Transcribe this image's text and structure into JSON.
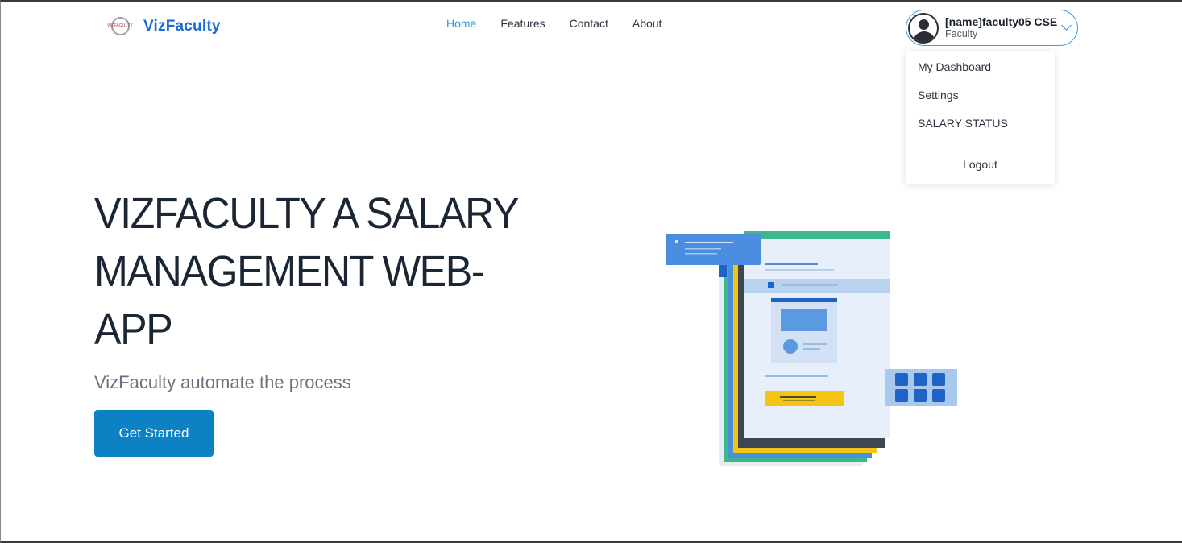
{
  "brand": {
    "logo_small_text": "VIZFACULTY",
    "name": "VizFaculty"
  },
  "nav": {
    "items": [
      {
        "label": "Home",
        "active": true
      },
      {
        "label": "Features",
        "active": false
      },
      {
        "label": "Contact",
        "active": false
      },
      {
        "label": "About",
        "active": false
      }
    ]
  },
  "user": {
    "name": "[name]faculty05 CSE",
    "role": "Faculty",
    "avatar_icon": "user-avatar-icon"
  },
  "dropdown": {
    "items": [
      {
        "label": "My Dashboard"
      },
      {
        "label": "Settings"
      },
      {
        "label": "SALARY STATUS"
      }
    ],
    "logout_label": "Logout"
  },
  "hero": {
    "title_lines": [
      "VIZFACULTY A SALARY",
      "MANAGEMENT WEB-",
      "APP"
    ],
    "subtitle": "VizFaculty automate the process",
    "cta_label": "Get Started"
  },
  "colors": {
    "brand_blue": "#1a6ad8",
    "nav_active": "#2b9bd6",
    "cta": "#0c82c4",
    "heading": "#1b2635"
  }
}
